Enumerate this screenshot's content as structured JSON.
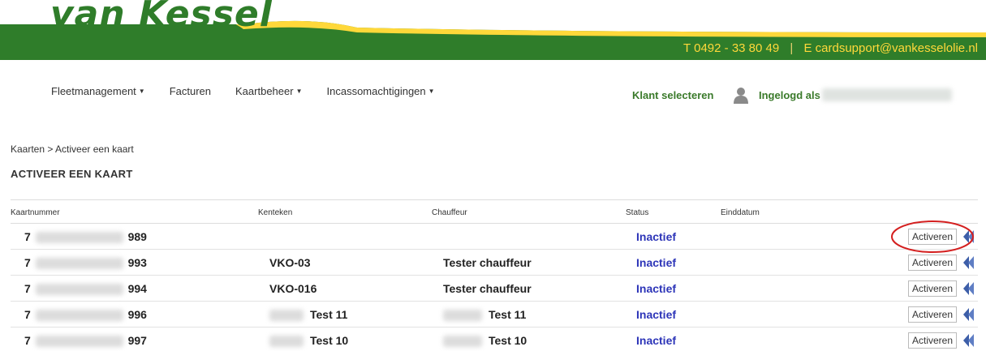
{
  "header": {
    "logo": "van Kessel",
    "phone_label": "T",
    "phone": "0492 - 33 80 49",
    "separator": "|",
    "email_label": "E",
    "email": "cardsupport@vankesselolie.nl",
    "colors": {
      "green": "#2f7d2a",
      "yellow": "#ffd83a"
    }
  },
  "nav": {
    "items": [
      {
        "label": "Fleetmanagement",
        "has_caret": true
      },
      {
        "label": "Facturen",
        "has_caret": false
      },
      {
        "label": "Kaartbeheer",
        "has_caret": true
      },
      {
        "label": "Incassomachtigingen",
        "has_caret": true
      }
    ],
    "klant": "Klant selecteren",
    "ingelogd": "Ingelogd als"
  },
  "breadcrumb": "Kaarten > Activeer een kaart",
  "page_title": "ACTIVEER EEN KAART",
  "table": {
    "headers": [
      "Kaartnummer",
      "Kenteken",
      "Chauffeur",
      "Status",
      "Einddatum"
    ],
    "rows": [
      {
        "kaart_prefix": "7",
        "kaart_suffix": "989",
        "kenteken": "",
        "kenteken_blur": false,
        "chauffeur": "",
        "chauffeur_blur": false,
        "status": "Inactief",
        "action": "Activeren"
      },
      {
        "kaart_prefix": "7",
        "kaart_suffix": "993",
        "kenteken": "VKO-03",
        "kenteken_blur": false,
        "chauffeur": "Tester chauffeur",
        "chauffeur_blur": false,
        "status": "Inactief",
        "action": "Activeren"
      },
      {
        "kaart_prefix": "7",
        "kaart_suffix": "994",
        "kenteken": "VKO-016",
        "kenteken_blur": false,
        "chauffeur": "Tester chauffeur",
        "chauffeur_blur": false,
        "status": "Inactief",
        "action": "Activeren"
      },
      {
        "kaart_prefix": "7",
        "kaart_suffix": "996",
        "kenteken": "Test 11",
        "kenteken_blur": true,
        "chauffeur": "Test 11",
        "chauffeur_blur": true,
        "status": "Inactief",
        "action": "Activeren"
      },
      {
        "kaart_prefix": "7",
        "kaart_suffix": "997",
        "kenteken": "Test 10",
        "kenteken_blur": true,
        "chauffeur": "Test 10",
        "chauffeur_blur": true,
        "status": "Inactief",
        "action": "Activeren"
      }
    ]
  }
}
